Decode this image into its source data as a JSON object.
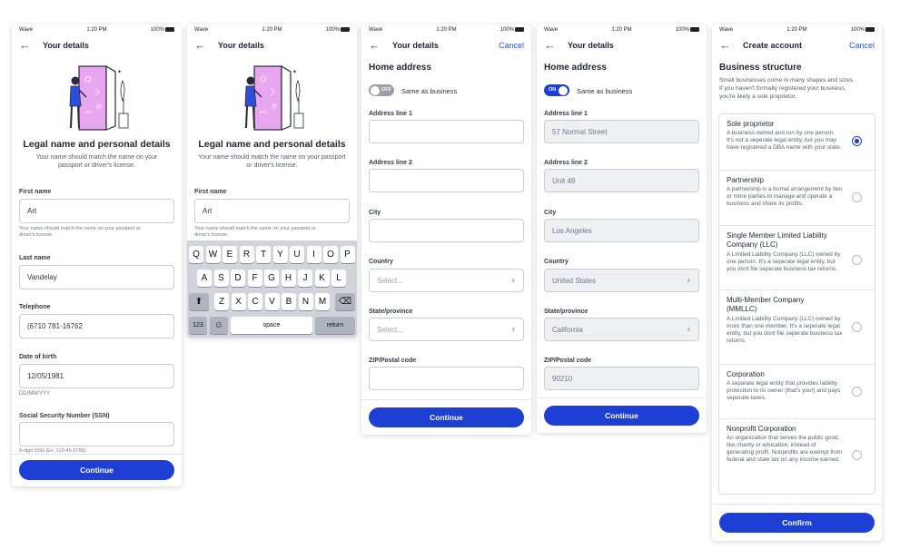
{
  "status": {
    "carrier": "Wave",
    "time": "1:20 PM",
    "battery": "100%"
  },
  "screen1": {
    "nav_title": "Your details",
    "heading": "Legal name and personal details",
    "subtext1": "Your name should match the name on your",
    "subtext2": "passport or driver's license.",
    "first_name_label": "First name",
    "first_name_value": "Art",
    "first_name_hint1": "Your name should match the name on your passport or",
    "first_name_hint2": "driver's license.",
    "last_name_label": "Last name",
    "last_name_value": "Vandelay",
    "telephone_label": "Telephone",
    "telephone_value": "(6710 781-16762",
    "dob_label": "Date of birth",
    "dob_value": "12/05/1981",
    "dob_hint": "DD/MM/YYY",
    "ssn_label": "Social Security Number (SSN)",
    "ssn_hint": "9-digit SSN (Ex: 123-45-6789)",
    "continue": "Continue"
  },
  "screen2": {
    "nav_title": "Your details",
    "heading": "Legal name and personal details",
    "subtext1": "Your name should match the name on your passport",
    "subtext2": "or driver's license.",
    "first_name_label": "First name",
    "first_name_value": "Art",
    "first_name_hint1": "Your name should match the name on your passport or",
    "first_name_hint2": "driver's license.",
    "keyboard": {
      "row1": [
        "Q",
        "W",
        "E",
        "R",
        "T",
        "Y",
        "U",
        "I",
        "O",
        "P"
      ],
      "row2": [
        "A",
        "S",
        "D",
        "F",
        "G",
        "H",
        "J",
        "K",
        "L"
      ],
      "row3": [
        "Z",
        "X",
        "C",
        "V",
        "B",
        "N",
        "M"
      ],
      "numbers": "123",
      "emoji": "☺",
      "space": "space",
      "return": "return",
      "shift": "⬆",
      "delete": "⌫"
    }
  },
  "screen3": {
    "nav_title": "Your details",
    "cancel": "Cancel",
    "section": "Home address",
    "toggle_text": "OFF",
    "same_as_business": "Same as business",
    "addr1_label": "Address line 1",
    "addr2_label": "Address line 2",
    "city_label": "City",
    "country_label": "Country",
    "country_placeholder": "Select...",
    "state_label": "State/province",
    "state_placeholder": "Select...",
    "zip_label": "ZIP/Postal code",
    "continue": "Continue"
  },
  "screen4": {
    "nav_title": "Your details",
    "cancel": "Cancel",
    "section": "Home address",
    "toggle_text": "ON",
    "same_as_business": "Same as business",
    "addr1_label": "Address line 1",
    "addr1_value": "57 Normal Street",
    "addr2_label": "Address line 2",
    "addr2_value": "Unit 48",
    "city_label": "City",
    "city_value": "Los Angeles",
    "country_label": "Country",
    "country_value": "United States",
    "state_label": "State/province",
    "state_value": "California",
    "zip_label": "ZIP/Postal code",
    "zip_value": "90210",
    "continue": "Continue"
  },
  "screen5": {
    "nav_title": "Create account",
    "cancel": "Cancel",
    "section": "Business structure",
    "intro1": "Small businesses come in many shapes and sizes.",
    "intro2": "If you haven't formally registered your business,",
    "intro3": "you're likely a sole proprietor.",
    "options": [
      {
        "title": "Sole proprietor",
        "desc": "A business owned and run by one person. It's not a seperate legal entity, but you may have registered a DBA name with your state.",
        "selected": true
      },
      {
        "title": "Partnership",
        "desc": "A partnership is a formal arrangement by two or more parties to manage and operate a business and share its profits.",
        "selected": false
      },
      {
        "title": "Single Member Limited Liability Company (LLC)",
        "desc": "A Limited Liability Company (LLC) owned by one person. It's a seperate legal entity, but you dont file seperate business tax returns.",
        "selected": false
      },
      {
        "title": "Multi-Member Company (MMLLC)",
        "desc": "A Limited Liability Company (LLC) owned by more than one member. It's a seperate legal entity, but you dont file seperate business tax returns.",
        "selected": false
      },
      {
        "title": "Corporation",
        "desc": "A separate legal entity that provides liability protection to its owner (that's you!) and pays seperate taxes.",
        "selected": false
      },
      {
        "title": "Nonprofit Corporation",
        "desc": "An organization that serves the public good, like charity or education, instead of generating profit. Nonprofits are exempt from federal and state tax on any income earned.",
        "selected": false
      }
    ],
    "confirm": "Confirm"
  },
  "colors": {
    "primary": "#1d3fd3",
    "link": "#2b55d6",
    "toggle_off": "#9a9fa8"
  }
}
